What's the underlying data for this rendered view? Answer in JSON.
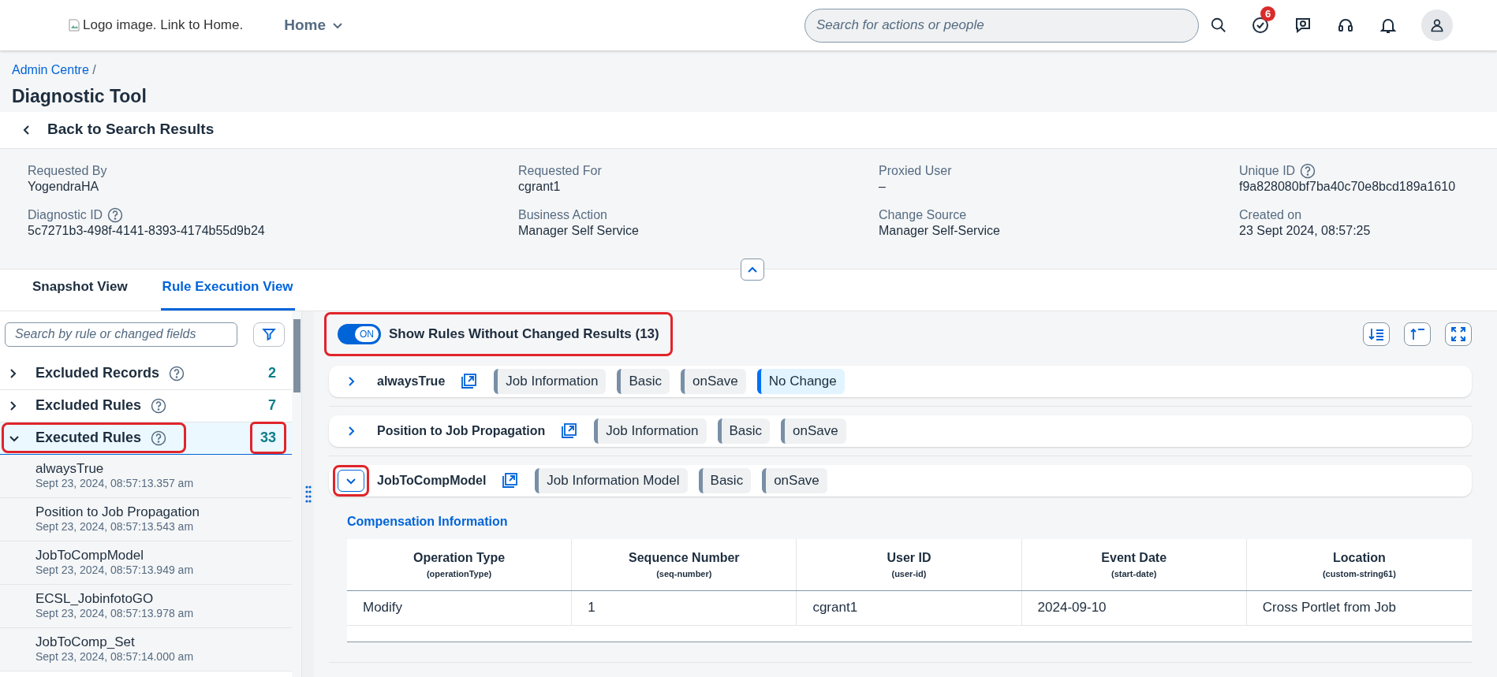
{
  "header": {
    "logo_alt": "Logo image. Link to Home.",
    "home_menu": "Home",
    "search": {
      "placeholder": "Search for actions or people"
    },
    "todo_badge": "6"
  },
  "breadcrumb": {
    "link": "Admin Centre",
    "separator": "/"
  },
  "page_title": "Diagnostic Tool",
  "back_link": "Back to Search Results",
  "details": [
    {
      "label": "Requested By",
      "value": "YogendraHA",
      "help": false
    },
    {
      "label": "Requested For",
      "value": "cgrant1",
      "help": false
    },
    {
      "label": "Proxied User",
      "value": "–",
      "help": false
    },
    {
      "label": "Unique ID",
      "value": "f9a828080bf7ba40c70e8bcd189a1610",
      "help": true
    },
    {
      "label": "Diagnostic ID",
      "value": "5c7271b3-498f-4141-8393-4174b55d9b24",
      "help": true
    },
    {
      "label": "Business Action",
      "value": "Manager Self Service",
      "help": false
    },
    {
      "label": "Change Source",
      "value": "Manager Self-Service",
      "help": false
    },
    {
      "label": "Created on",
      "value": "23 Sept 2024, 08:57:25",
      "help": false
    }
  ],
  "tabs": [
    {
      "label": "Snapshot View",
      "selected": false
    },
    {
      "label": "Rule Execution View",
      "selected": true
    }
  ],
  "sidebar": {
    "search": {
      "placeholder": "Search by rule or changed fields"
    },
    "groups": [
      {
        "label": "Excluded Records",
        "count": "2",
        "expanded": false,
        "selected": false,
        "highlighted": false
      },
      {
        "label": "Excluded Rules",
        "count": "7",
        "expanded": false,
        "selected": false,
        "highlighted": false
      },
      {
        "label": "Executed Rules",
        "count": "33",
        "expanded": true,
        "selected": true,
        "highlighted": true,
        "children": [
          {
            "name": "alwaysTrue",
            "time": "Sept 23, 2024, 08:57:13.357 am"
          },
          {
            "name": "Position to Job Propagation",
            "time": "Sept 23, 2024, 08:57:13.543 am"
          },
          {
            "name": "JobToCompModel",
            "time": "Sept 23, 2024, 08:57:13.949 am"
          },
          {
            "name": "ECSL_JobinfotoGO",
            "time": "Sept 23, 2024, 08:57:13.978 am"
          },
          {
            "name": "JobToComp_Set",
            "time": "Sept 23, 2024, 08:57:14.000 am"
          }
        ]
      }
    ]
  },
  "toolbar": {
    "toggle": {
      "on": true,
      "text": "ON",
      "label": "Show Rules Without Changed Results (13)",
      "highlighted": true
    }
  },
  "rules": [
    {
      "name": "alwaysTrue",
      "expanded": false,
      "highlighted": false,
      "tags": [
        {
          "label": "Job Information",
          "kind": "neutral"
        },
        {
          "label": "Basic",
          "kind": "neutral"
        },
        {
          "label": "onSave",
          "kind": "neutral"
        },
        {
          "label": "No Change",
          "kind": "info"
        }
      ]
    },
    {
      "name": "Position to Job Propagation",
      "expanded": false,
      "highlighted": false,
      "tags": [
        {
          "label": "Job Information",
          "kind": "neutral"
        },
        {
          "label": "Basic",
          "kind": "neutral"
        },
        {
          "label": "onSave",
          "kind": "neutral"
        }
      ]
    },
    {
      "name": "JobToCompModel",
      "expanded": true,
      "highlighted": true,
      "tags": [
        {
          "label": "Job Information Model",
          "kind": "neutral"
        },
        {
          "label": "Basic",
          "kind": "neutral"
        },
        {
          "label": "onSave",
          "kind": "neutral"
        }
      ],
      "section": "Compensation Information",
      "table": {
        "columns": [
          {
            "title": "Operation Type",
            "field": "(operationType)"
          },
          {
            "title": "Sequence Number",
            "field": "(seq-number)"
          },
          {
            "title": "User ID",
            "field": "(user-id)"
          },
          {
            "title": "Event Date",
            "field": "(start-date)"
          },
          {
            "title": "Location",
            "field": "(custom-string61)"
          }
        ],
        "rows": [
          [
            "Modify",
            "1",
            "cgrant1",
            "2024-09-10",
            "Cross Portlet from Job"
          ]
        ]
      }
    }
  ]
}
